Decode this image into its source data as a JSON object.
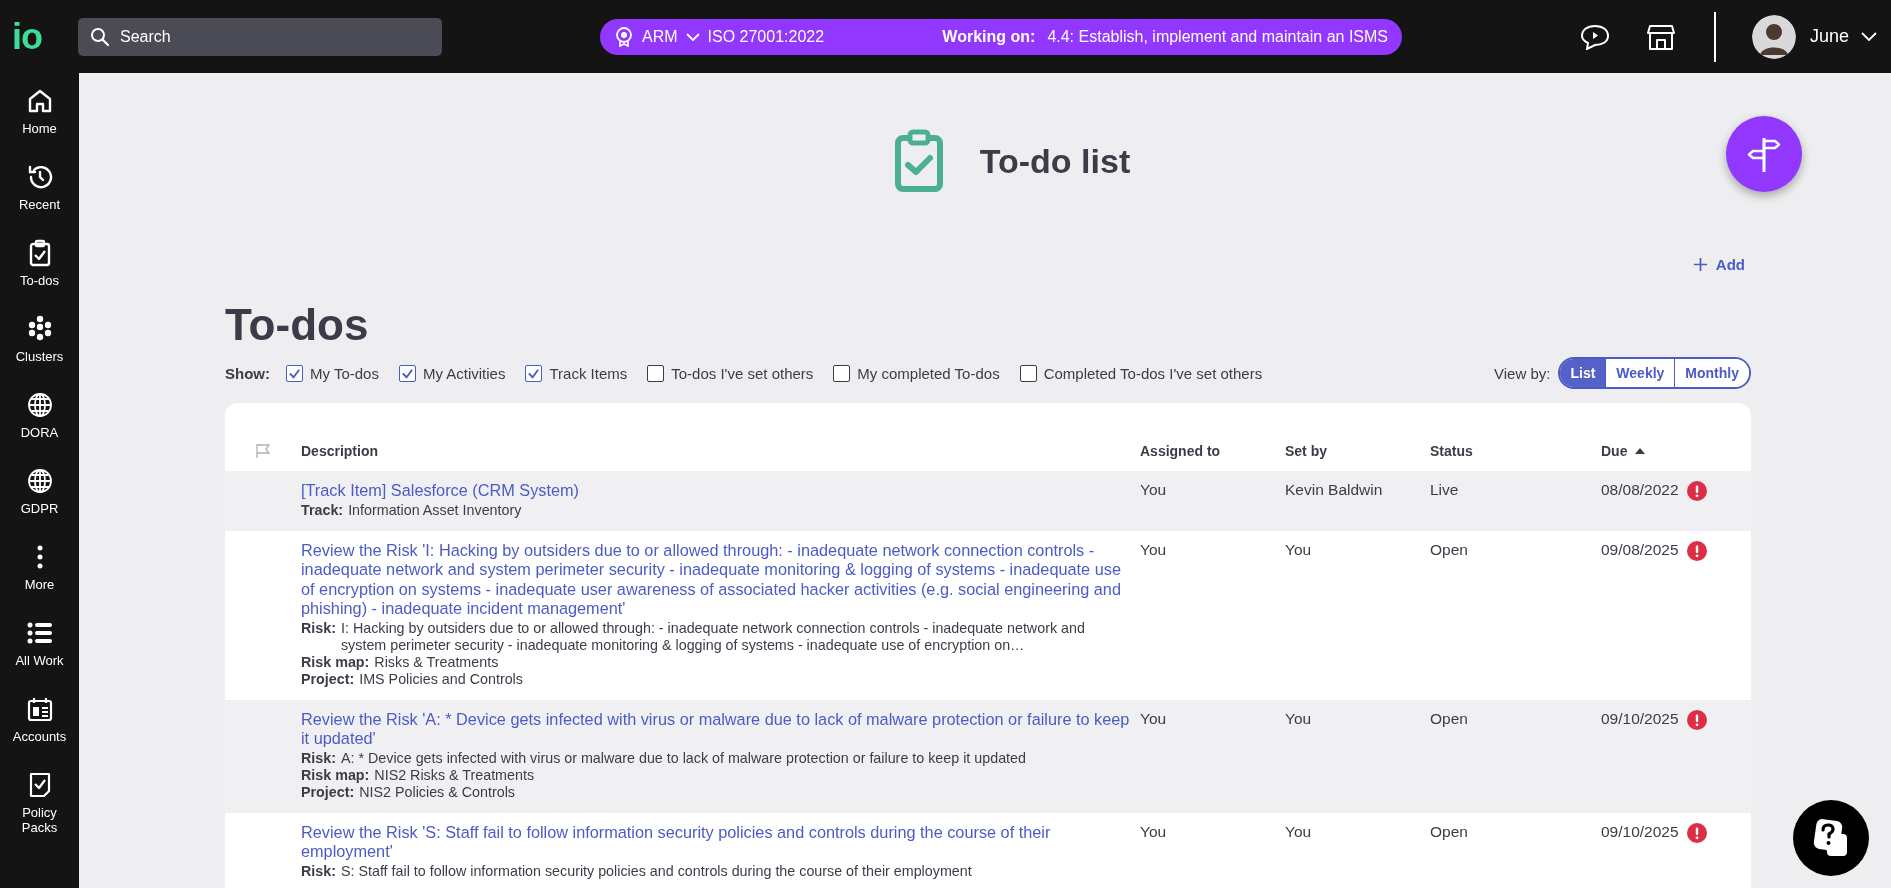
{
  "topbar": {
    "logo": "io",
    "search": {
      "placeholder": "Search"
    },
    "context": {
      "org": "ARM",
      "standard": "ISO 27001:2022",
      "working_label": "Working on:",
      "working_value": "4.4: Establish, implement and maintain an ISMS"
    },
    "user": "June"
  },
  "sidebar": {
    "items": [
      {
        "label": "Home"
      },
      {
        "label": "Recent"
      },
      {
        "label": "To-dos"
      },
      {
        "label": "Clusters"
      },
      {
        "label": "DORA"
      },
      {
        "label": "GDPR"
      },
      {
        "label": "More"
      },
      {
        "label": "All Work"
      },
      {
        "label": "Accounts"
      },
      {
        "label": "Policy Packs"
      }
    ]
  },
  "page": {
    "title": "To-do list",
    "add": "Add",
    "heading": "To-dos"
  },
  "filters": {
    "label": "Show:",
    "options": [
      {
        "label": "My To-dos",
        "checked": true
      },
      {
        "label": "My Activities",
        "checked": true
      },
      {
        "label": "Track Items",
        "checked": true
      },
      {
        "label": "To-dos I've set others",
        "checked": false
      },
      {
        "label": "My completed To-dos",
        "checked": false
      },
      {
        "label": "Completed To-dos I've set others",
        "checked": false
      }
    ]
  },
  "view_by": {
    "label": "View by:",
    "options": [
      {
        "label": "List",
        "selected": true
      },
      {
        "label": "Weekly",
        "selected": false
      },
      {
        "label": "Monthly",
        "selected": false
      }
    ]
  },
  "table": {
    "columns": [
      "Description",
      "Assigned to",
      "Set by",
      "Status",
      "Due"
    ],
    "rows": [
      {
        "title": "[Track Item] Salesforce (CRM System)",
        "details": [
          {
            "label": "Track:",
            "value": "Information Asset Inventory"
          }
        ],
        "assigned_to": "You",
        "set_by": "Kevin Baldwin",
        "status": "Live",
        "due": "08/08/2022",
        "overdue": true
      },
      {
        "title": "Review the Risk 'I: Hacking by outsiders due to or allowed through: - inadequate network connection controls - inadequate network and system perimeter security - inadequate monitoring & logging of systems - inadequate use of encryption on systems - inadequate user awareness of associated hacker activities (e.g. social engineering and phishing) - inadequate incident management'",
        "details": [
          {
            "label": "Risk:",
            "value": "I: Hacking by outsiders due to or allowed through: - inadequate network connection controls - inadequate network and system perimeter security - inadequate monitoring & logging of systems - inadequate use of encryption on…"
          },
          {
            "label": "Risk map:",
            "value": "Risks & Treatments"
          },
          {
            "label": "Project:",
            "value": "IMS Policies and Controls"
          }
        ],
        "assigned_to": "You",
        "set_by": "You",
        "status": "Open",
        "due": "09/08/2025",
        "overdue": true
      },
      {
        "title": "Review the Risk 'A: * Device gets infected with virus or malware due to lack of malware protection or failure to keep it updated'",
        "details": [
          {
            "label": "Risk:",
            "value": "A: * Device gets infected with virus or malware due to lack of malware protection or failure to keep it updated"
          },
          {
            "label": "Risk map:",
            "value": "NIS2 Risks & Treatments"
          },
          {
            "label": "Project:",
            "value": "NIS2 Policies & Controls"
          }
        ],
        "assigned_to": "You",
        "set_by": "You",
        "status": "Open",
        "due": "09/10/2025",
        "overdue": true
      },
      {
        "title": "Review the Risk 'S: Staff fail to follow information security policies and controls during the course of their employment'",
        "details": [
          {
            "label": "Risk:",
            "value": "S: Staff fail to follow information security policies and controls during the course of their employment"
          }
        ],
        "assigned_to": "You",
        "set_by": "You",
        "status": "Open",
        "due": "09/10/2025",
        "overdue": true
      }
    ]
  }
}
